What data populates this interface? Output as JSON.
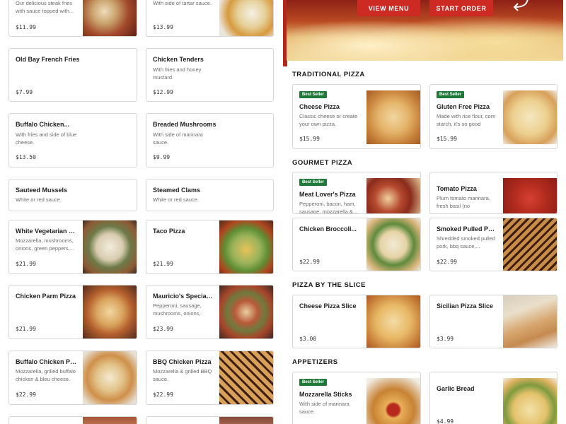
{
  "hero": {
    "view_menu_label": "VIEW MENU",
    "start_order_label": "START ORDER"
  },
  "left_menu": [
    {
      "title": "",
      "desc": "Our delicious steak fries with sauce topped with...",
      "price": "$11.99",
      "image": "loaded-fries-photo"
    },
    {
      "title": "",
      "desc": "With side of tartar sauce.",
      "price": "$13.99",
      "image": "fried-fish-photo"
    },
    {
      "title": "Old Bay French Fries",
      "desc": "",
      "price": "$7.99"
    },
    {
      "title": "Chicken Tenders",
      "desc": "With fries and honey mustard.",
      "price": "$12.99"
    },
    {
      "title": "Buffalo Chicken...",
      "desc": "With fries and side of blue cheese.",
      "price": "$13.50"
    },
    {
      "title": "Breaded Mushrooms",
      "desc": "With side of marinara sauce.",
      "price": "$9.99"
    },
    {
      "title": "Sauteed Mussels",
      "desc": "White or red sauce.",
      "price": ""
    },
    {
      "title": "Steamed Clams",
      "desc": "White or red sauce.",
      "price": ""
    },
    {
      "title": "White Vegetarian Pizza",
      "desc": "Mozzarella, mushrooms, onions, green peppers,...",
      "price": "$21.99",
      "image": "white-veggie-pizza-photo"
    },
    {
      "title": "Taco Pizza",
      "desc": "",
      "price": "$21.99",
      "image": "taco-pizza-photo"
    },
    {
      "title": "Chicken Parm Pizza",
      "desc": "",
      "price": "$21.99",
      "image": "chicken-parm-pizza-photo"
    },
    {
      "title": "Mauricio's Special Pizza",
      "desc": "Pepperoni, sausage, mushrooms, onions, gree...",
      "price": "$23.99",
      "image": "special-pizza-photo"
    },
    {
      "title": "Buffalo Chicken Pizza",
      "desc": "Mozzarella, grilled buffalo chicken & bleu cheese.",
      "price": "$22.99",
      "image": "buffalo-chicken-pizza-photo"
    },
    {
      "title": "BBQ Chicken Pizza",
      "desc": "Mozzarella & grilled BBQ sauce.",
      "price": "$22.99",
      "image": "bbq-chicken-pizza-photo"
    }
  ],
  "sections": [
    {
      "heading": "TRADITIONAL PIZZA",
      "items": [
        {
          "badge": "Best Seller",
          "title": "Cheese Pizza",
          "desc": "Classic cheese or create your own pizza.",
          "price": "$15.99",
          "image": "cheese-pizza-photo"
        },
        {
          "badge": "Best Seller",
          "title": "Gluten Free Pizza",
          "desc": "Made with rice flour, corn starch, it's so good",
          "price": "$15.99",
          "image": "gluten-free-pizza-photo"
        }
      ]
    },
    {
      "heading": "GOURMET PIZZA",
      "items": [
        {
          "badge": "Best Seller",
          "title": "Meat Lover's Pizza",
          "desc": "Pepperoni, bacon, ham, sausage, mozzarella &...",
          "price": "",
          "image": "meat-lovers-pizza-photo"
        },
        {
          "badge": "",
          "title": "Tomato Pizza",
          "desc": "Plum tomato marinara, fresh basil (no cheese).Ad...",
          "price": "",
          "image": "tomato-pizza-photo"
        },
        {
          "badge": "",
          "title": "Chicken Broccoli...",
          "desc": "",
          "price": "$22.99",
          "image": "chicken-broccoli-pizza-photo"
        },
        {
          "badge": "",
          "title": "Smoked Pulled Pork...",
          "desc": "Shredded smoked pulled pork, bbq sauce,...",
          "price": "$22.99",
          "image": "pulled-pork-pizza-photo"
        }
      ]
    },
    {
      "heading": "PIZZA BY THE SLICE",
      "items": [
        {
          "badge": "",
          "title": "Cheese Pizza Slice",
          "desc": "",
          "price": "$3.00",
          "image": "cheese-slice-photo"
        },
        {
          "badge": "",
          "title": "Sicilian Pizza Slice",
          "desc": "",
          "price": "$3.99",
          "image": "sicilian-slice-photo"
        }
      ]
    },
    {
      "heading": "APPETIZERS",
      "items": [
        {
          "badge": "Best Seller",
          "title": "Mozzarella Sticks",
          "desc": "With side of marinara sauce.",
          "price": "",
          "image": "mozzarella-sticks-photo"
        },
        {
          "badge": "",
          "title": "Garlic Bread",
          "desc": "",
          "price": "$4.99",
          "image": "garlic-bread-photo"
        }
      ]
    }
  ],
  "colors": {
    "brand_red": "#cc2a22",
    "badge_green": "#1f7a3a",
    "card_border": "#d6d6d6"
  }
}
